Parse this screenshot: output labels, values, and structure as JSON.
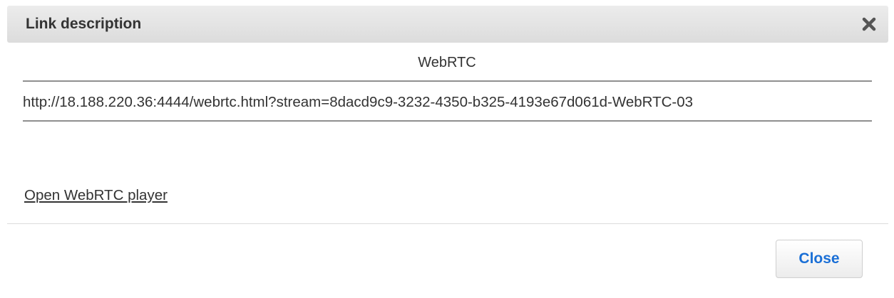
{
  "dialog": {
    "title": "Link description",
    "close_icon": "close-x-icon",
    "section_title": "WebRTC",
    "url": "http://18.188.220.36:4444/webrtc.html?stream=8dacd9c9-3232-4350-b325-4193e67d061d-WebRTC-03",
    "link_label": "Open WebRTC player",
    "close_button_label": "Close",
    "colors": {
      "header_bg": "#e4e4e4",
      "button_text": "#1a6fd6",
      "rule": "#8f8f8f"
    }
  }
}
